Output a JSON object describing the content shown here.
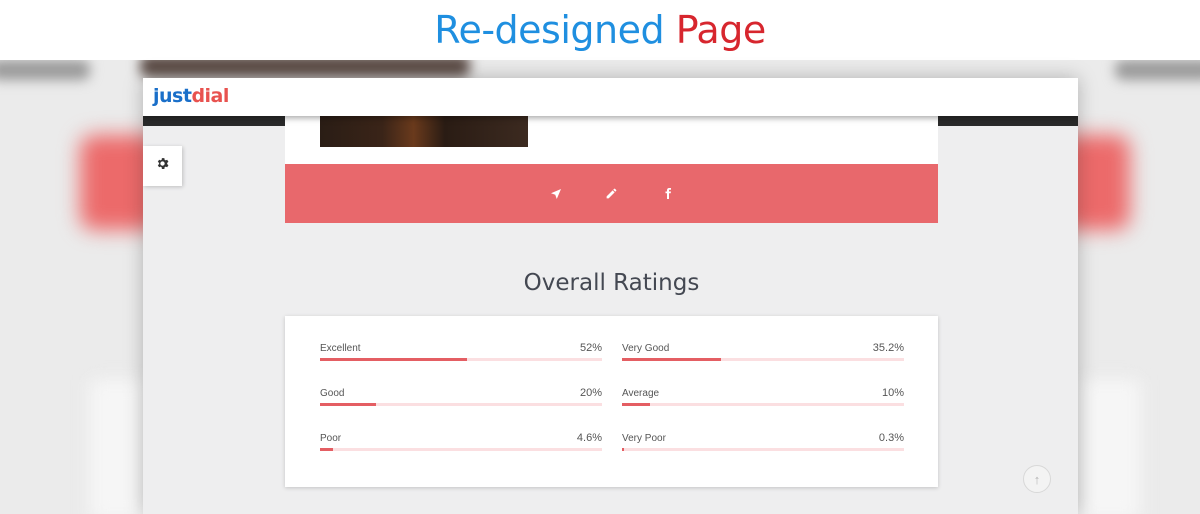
{
  "banner": {
    "title_part1": "Re-designed",
    "title_part2": "Page"
  },
  "header": {
    "logo_part1": "just",
    "logo_part2": "dial"
  },
  "icons": {
    "settings": "gear-icon",
    "actions": [
      "navigate-icon",
      "pencil-icon",
      "facebook-icon"
    ],
    "scroll_top": "arrow-up-icon"
  },
  "ratings": {
    "title": "Overall Ratings",
    "items": [
      {
        "label": "Excellent",
        "percent": "52%",
        "value": 52
      },
      {
        "label": "Very Good",
        "percent": "35.2%",
        "value": 35.2
      },
      {
        "label": "Good",
        "percent": "20%",
        "value": 20
      },
      {
        "label": "Average",
        "percent": "10%",
        "value": 10
      },
      {
        "label": "Poor",
        "percent": "4.6%",
        "value": 4.6
      },
      {
        "label": "Very Poor",
        "percent": "0.3%",
        "value": 0.3
      }
    ]
  },
  "colors": {
    "accent": "#e8686c",
    "bar_fill": "#e45e63",
    "bar_track": "#fbdfe1",
    "logo_blue": "#1a6fc9",
    "logo_red": "#e8524f",
    "banner_blue": "#1f8fe0",
    "banner_red": "#d7262e"
  }
}
